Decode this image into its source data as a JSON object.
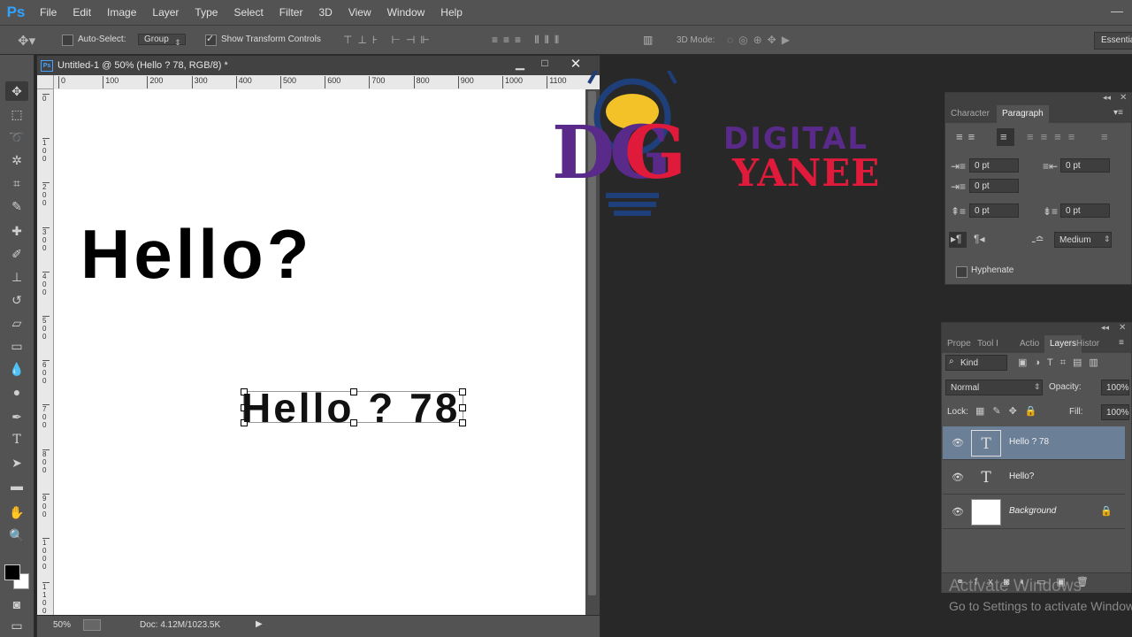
{
  "app": {
    "logo": "Ps"
  },
  "menu": [
    "File",
    "Edit",
    "Image",
    "Layer",
    "Type",
    "Select",
    "Filter",
    "3D",
    "View",
    "Window",
    "Help"
  ],
  "options": {
    "auto_select_label": "Auto-Select:",
    "auto_select_value": "Group",
    "show_transform_label": "Show Transform Controls",
    "mode_3d_label": "3D Mode:",
    "workspace": "Essentials"
  },
  "document": {
    "title": "Untitled-1 @ 50% (Hello ? 78, RGB/8) *",
    "ps_badge": "Ps",
    "ruler_h": [
      "0",
      "100",
      "200",
      "300",
      "400",
      "500",
      "600",
      "700",
      "800",
      "900",
      "1000",
      "1100"
    ],
    "ruler_v": [
      "0",
      "100",
      "200",
      "300",
      "400",
      "500",
      "600",
      "700",
      "800",
      "900",
      "1000",
      "1100"
    ],
    "text1": "Hello?",
    "text2": "Hello ? 78",
    "zoom": "50%",
    "doc_size": "Doc: 4.12M/1023.5K"
  },
  "watermark": {
    "dg": "DG",
    "line1": "DIGITAL",
    "line2": "YANEE"
  },
  "paragraph_panel": {
    "tabs": [
      "Character",
      "Paragraph"
    ],
    "indent_left": "0 pt",
    "indent_right": "0 pt",
    "indent_first": "0 pt",
    "space_before": "0 pt",
    "space_after": "0 pt",
    "composer": "Medium",
    "hyphenate_label": "Hyphenate"
  },
  "layers_panel": {
    "tabs": [
      "Prope",
      "Tool I",
      "Actio",
      "Layers",
      "Histor"
    ],
    "filter_kind": "Kind",
    "blend_mode": "Normal",
    "opacity_label": "Opacity:",
    "opacity_value": "100%",
    "lock_label": "Lock:",
    "fill_label": "Fill:",
    "fill_value": "100%",
    "layers": [
      {
        "name": "Hello ? 78",
        "type": "text",
        "selected": true
      },
      {
        "name": "Hello?",
        "type": "text",
        "selected": false
      },
      {
        "name": "Background",
        "type": "image",
        "selected": false
      }
    ]
  },
  "activation": {
    "line1": "Activate Windows",
    "line2": "Go to Settings to activate Windows."
  }
}
